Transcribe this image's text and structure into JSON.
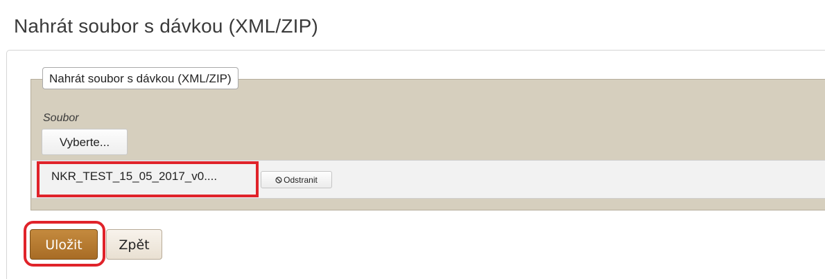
{
  "page": {
    "title": "Nahrát soubor s dávkou (XML/ZIP)"
  },
  "form": {
    "legend": "Nahrát soubor s dávkou (XML/ZIP)",
    "file_field": {
      "label": "Soubor",
      "choose_label": "Vyberte...",
      "selected_file_name": "NKR_TEST_15_05_2017_v0....",
      "remove_label": "Odstranit",
      "remove_icon": "ban-icon"
    }
  },
  "actions": {
    "save_label": "Uložit",
    "back_label": "Zpět"
  },
  "colors": {
    "save_button": "#b47a31",
    "fieldset_background": "#d6cfbe",
    "highlight": "#e0232a"
  }
}
